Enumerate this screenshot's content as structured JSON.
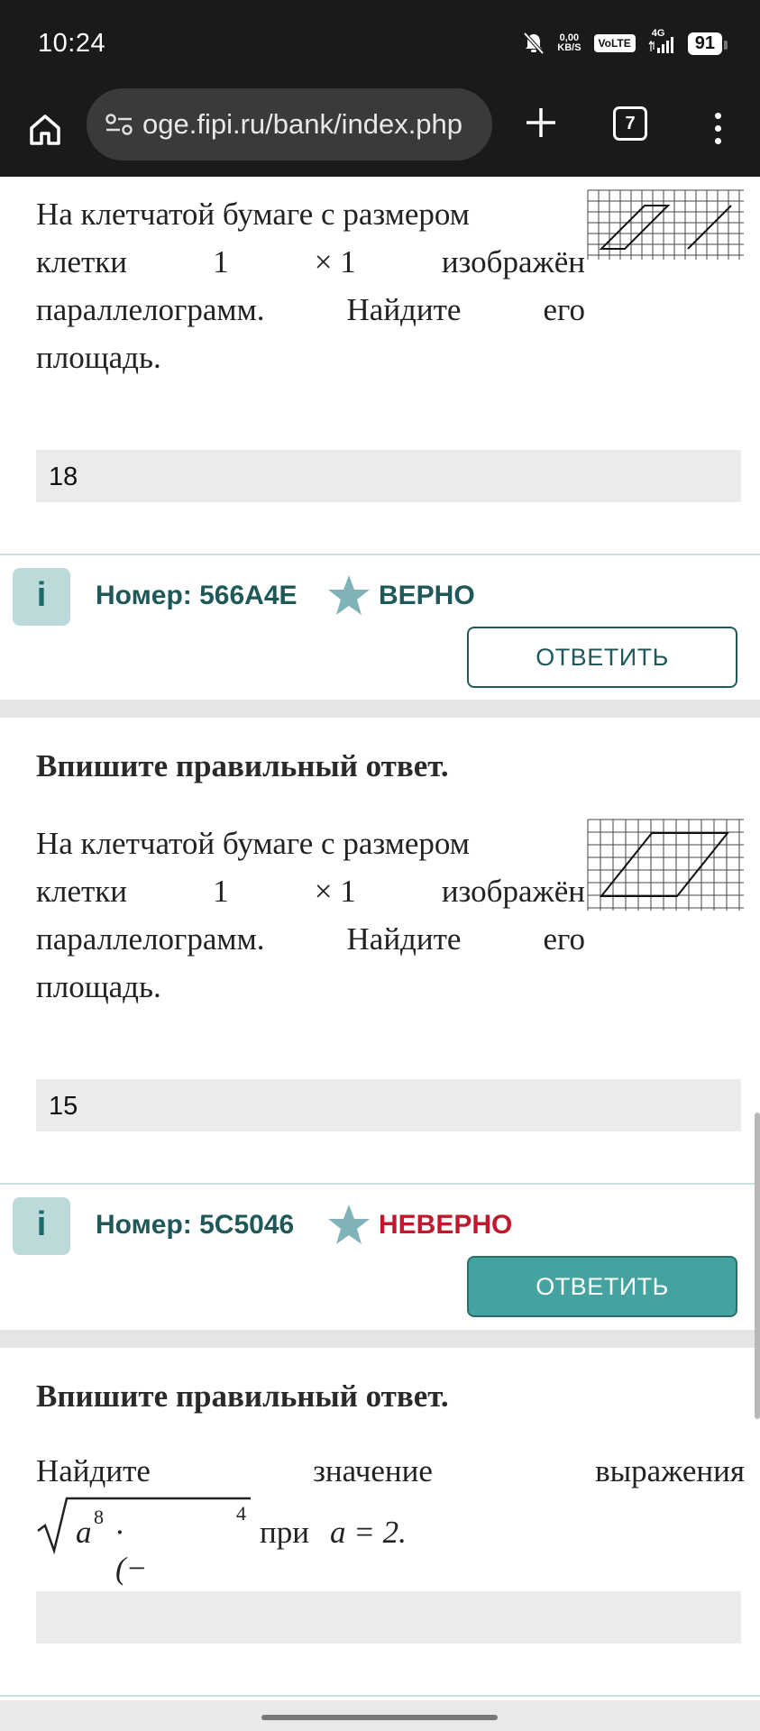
{
  "status_bar": {
    "time": "10:24",
    "net_speed_value": "0,00",
    "net_speed_unit": "KB/S",
    "volte": "VoLTE",
    "network": "4G",
    "battery": "91"
  },
  "browser": {
    "url": "oge.fipi.ru/bank/index.php",
    "tab_count": "7"
  },
  "tasks": [
    {
      "text_lines": [
        [
          "На клетчатой бумаге с размером"
        ],
        [
          "клетки",
          "1",
          "× 1",
          "изображён"
        ],
        [
          "параллелограмм.",
          "Найдите",
          "его"
        ],
        [
          "площадь."
        ]
      ],
      "answer": "18",
      "info_label": "i",
      "number": "Номер: 566A4E",
      "status": "ВЕРНО",
      "button": "ОТВЕТИТЬ"
    },
    {
      "title": "Впишите правильный ответ.",
      "text_lines": [
        [
          "На клетчатой бумаге с размером"
        ],
        [
          "клетки",
          "1",
          "× 1",
          "изображён"
        ],
        [
          "параллелограмм.",
          "Найдите",
          "его"
        ],
        [
          "площадь."
        ]
      ],
      "answer": "15",
      "info_label": "i",
      "number": "Номер: 5C5046",
      "status": "НЕВЕРНО",
      "button": "ОТВЕТИТЬ"
    },
    {
      "title": "Впишите правильный ответ.",
      "text_words": [
        "Найдите",
        "значение",
        "выражения"
      ],
      "formula_base": "a",
      "formula_exp1": "8",
      "formula_mid": "· (− a)",
      "formula_exp2": "4",
      "formula_suffix_word": "при",
      "formula_condition": "a = 2.",
      "answer": ""
    }
  ],
  "colors": {
    "accent": "#1f5858",
    "correct": "#1f5858",
    "incorrect": "#c0182d",
    "button_filled": "#45a39f"
  }
}
